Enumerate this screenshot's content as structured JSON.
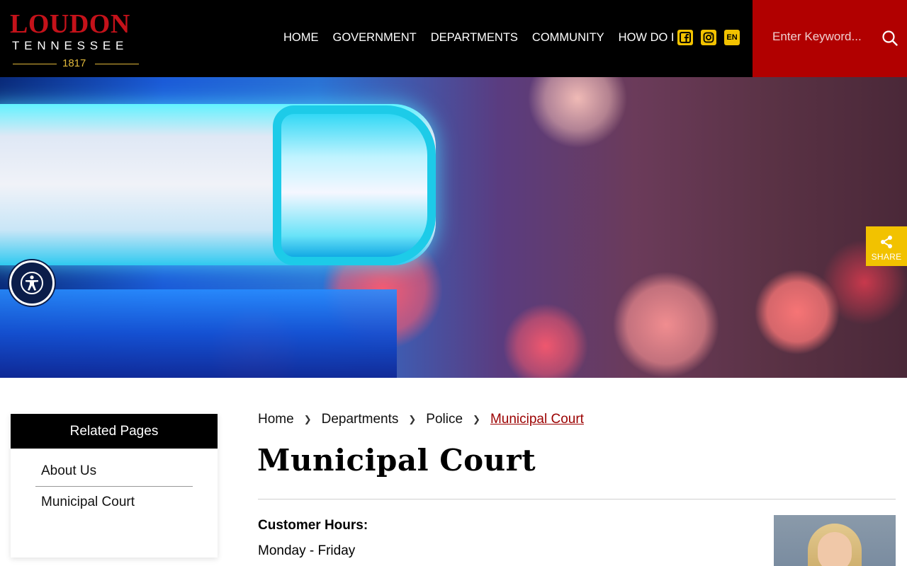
{
  "logo": {
    "name": "LOUDON",
    "state": "TENNESSEE",
    "year": "1817"
  },
  "nav": {
    "items": [
      "HOME",
      "GOVERNMENT",
      "DEPARTMENTS",
      "COMMUNITY",
      "HOW DO I"
    ],
    "language": "EN"
  },
  "search": {
    "placeholder": "Enter Keyword..."
  },
  "share": {
    "label": "SHARE"
  },
  "sidebar": {
    "title": "Related Pages",
    "items": [
      "About Us",
      "Municipal Court"
    ]
  },
  "breadcrumb": {
    "items": [
      "Home",
      "Departments",
      "Police",
      "Municipal Court"
    ]
  },
  "page": {
    "title": "Municipal Court",
    "hours_label": "Customer Hours:",
    "hours_days": "Monday - Friday"
  },
  "colors": {
    "header_bg": "#000000",
    "brand_red": "#c4121a",
    "search_bg": "#b10000",
    "accent_yellow": "#f2c200",
    "link_current": "#9b0000"
  }
}
